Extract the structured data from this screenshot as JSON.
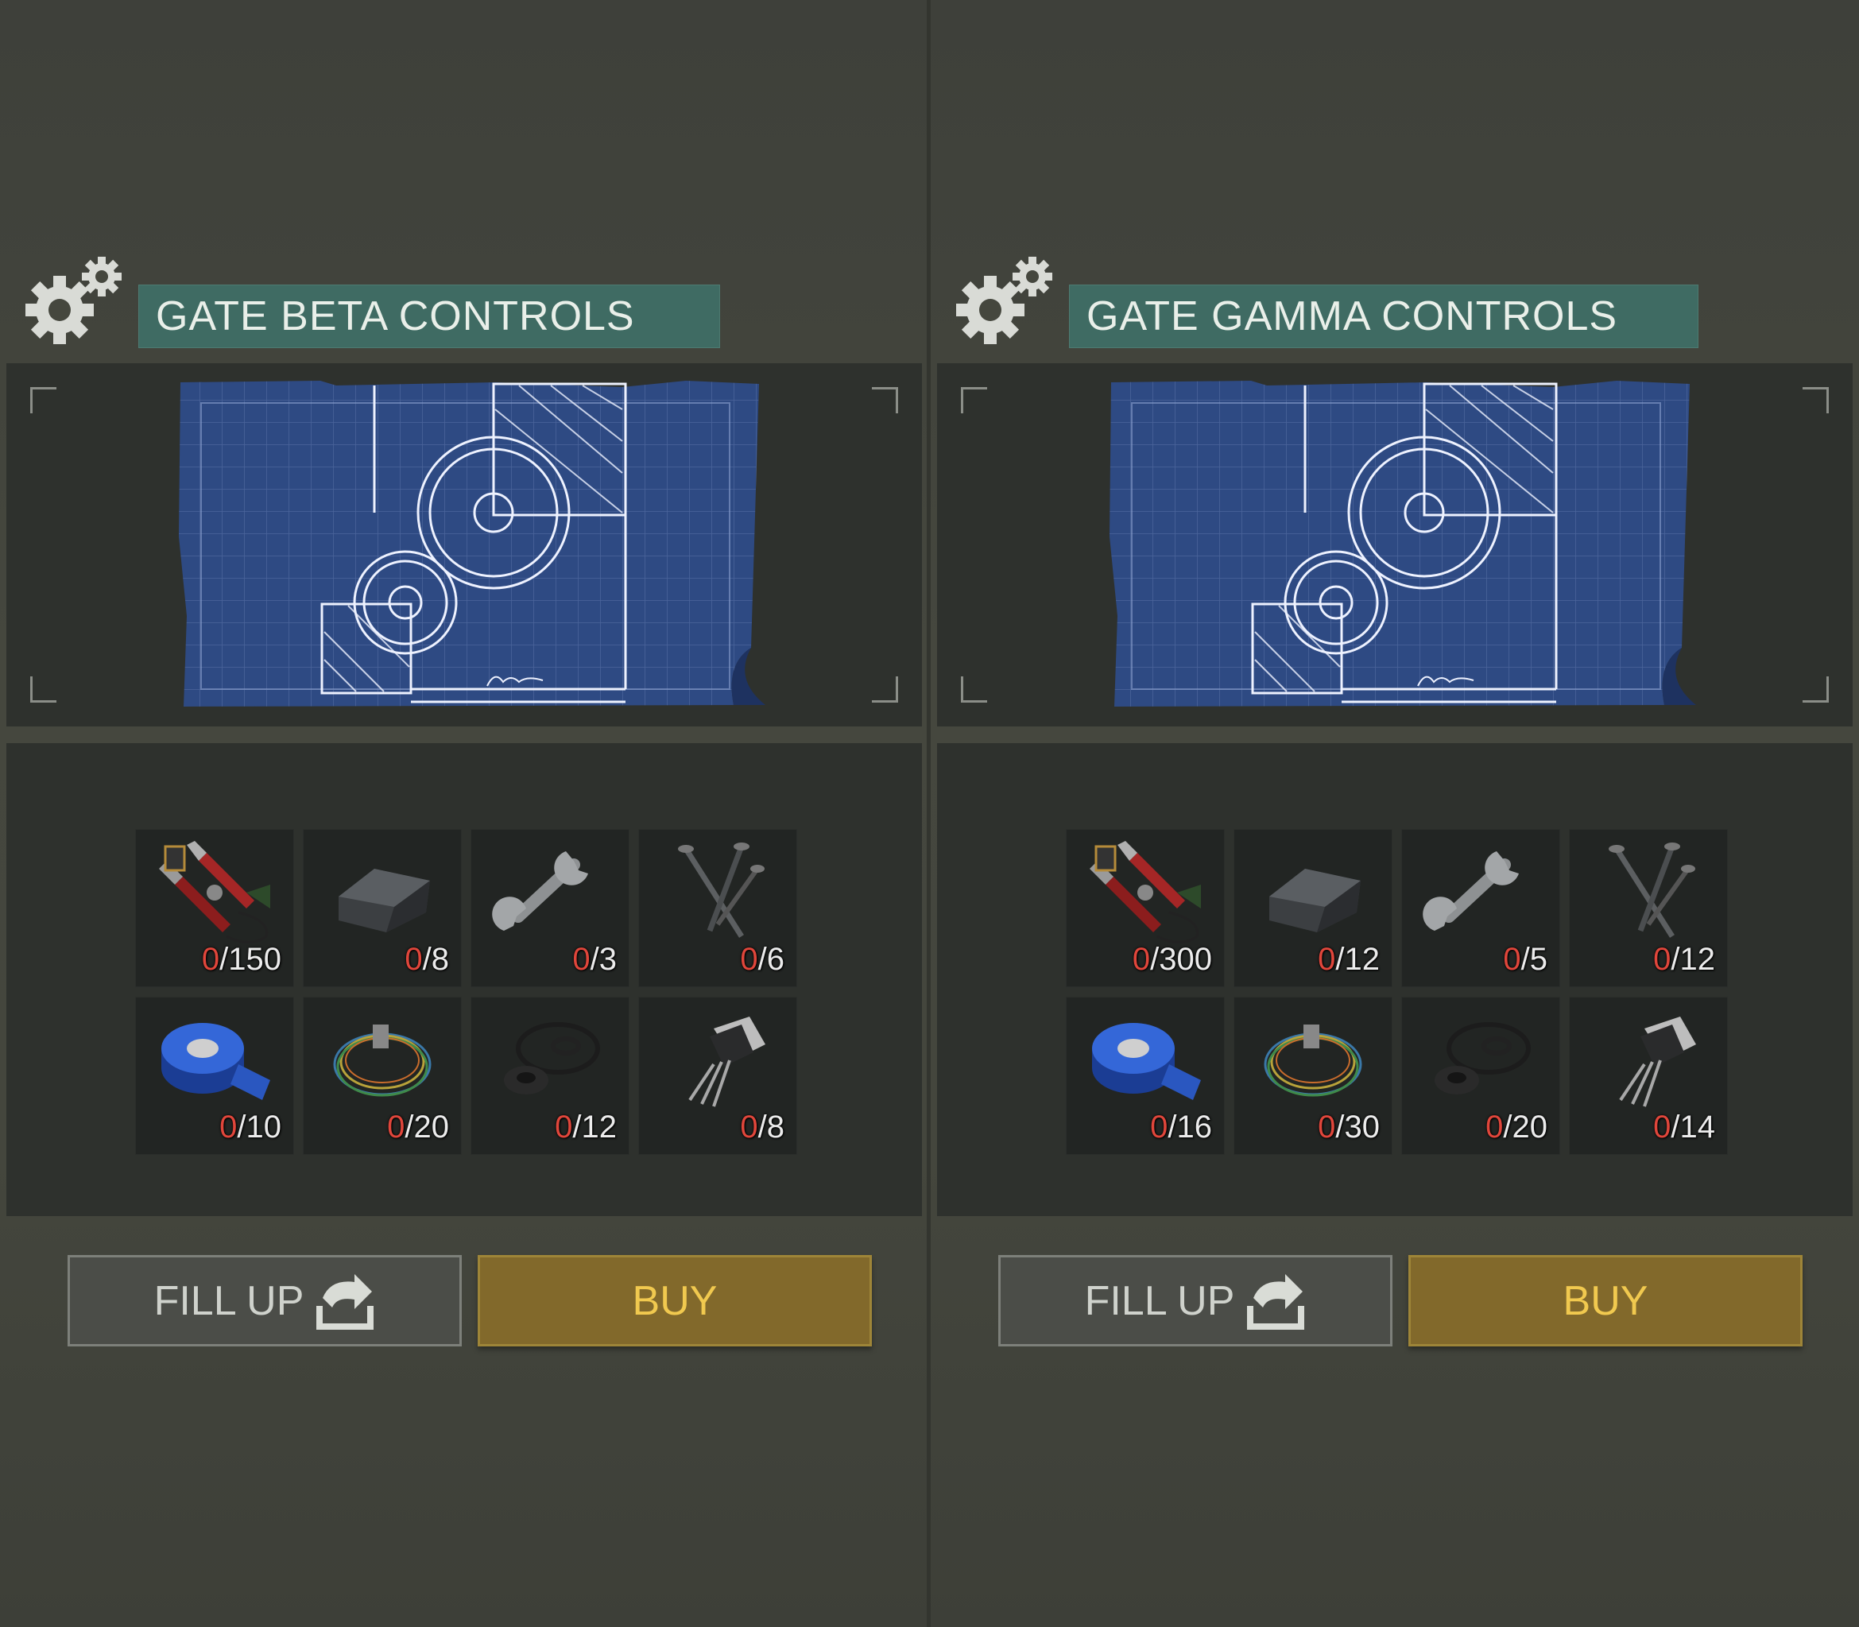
{
  "panels": [
    {
      "title": "GATE BETA CONTROLS",
      "resources": [
        {
          "icon": "tools-icon",
          "have": "0",
          "need": "/150"
        },
        {
          "icon": "iron-ingot-icon",
          "have": "0",
          "need": "/8"
        },
        {
          "icon": "wrench-icon",
          "have": "0",
          "need": "/3"
        },
        {
          "icon": "nails-icon",
          "have": "0",
          "need": "/6"
        },
        {
          "icon": "duct-tape-icon",
          "have": "0",
          "need": "/10"
        },
        {
          "icon": "wires-icon",
          "have": "0",
          "need": "/20"
        },
        {
          "icon": "rubber-seals-icon",
          "have": "0",
          "need": "/12"
        },
        {
          "icon": "transistor-icon",
          "have": "0",
          "need": "/8"
        }
      ],
      "fill_label": "FILL UP",
      "buy_label": "BUY"
    },
    {
      "title": "GATE GAMMA CONTROLS",
      "resources": [
        {
          "icon": "tools-icon",
          "have": "0",
          "need": "/300"
        },
        {
          "icon": "iron-ingot-icon",
          "have": "0",
          "need": "/12"
        },
        {
          "icon": "wrench-icon",
          "have": "0",
          "need": "/5"
        },
        {
          "icon": "nails-icon",
          "have": "0",
          "need": "/12"
        },
        {
          "icon": "duct-tape-icon",
          "have": "0",
          "need": "/16"
        },
        {
          "icon": "wires-icon",
          "have": "0",
          "need": "/30"
        },
        {
          "icon": "rubber-seals-icon",
          "have": "0",
          "need": "/20"
        },
        {
          "icon": "transistor-icon",
          "have": "0",
          "need": "/14"
        }
      ],
      "fill_label": "FILL UP",
      "buy_label": "BUY"
    }
  ],
  "colors": {
    "title_bar": "#3f6b63",
    "buy_button": "#82692b",
    "buy_text": "#f1c94f",
    "missing_count": "#e0463b"
  }
}
